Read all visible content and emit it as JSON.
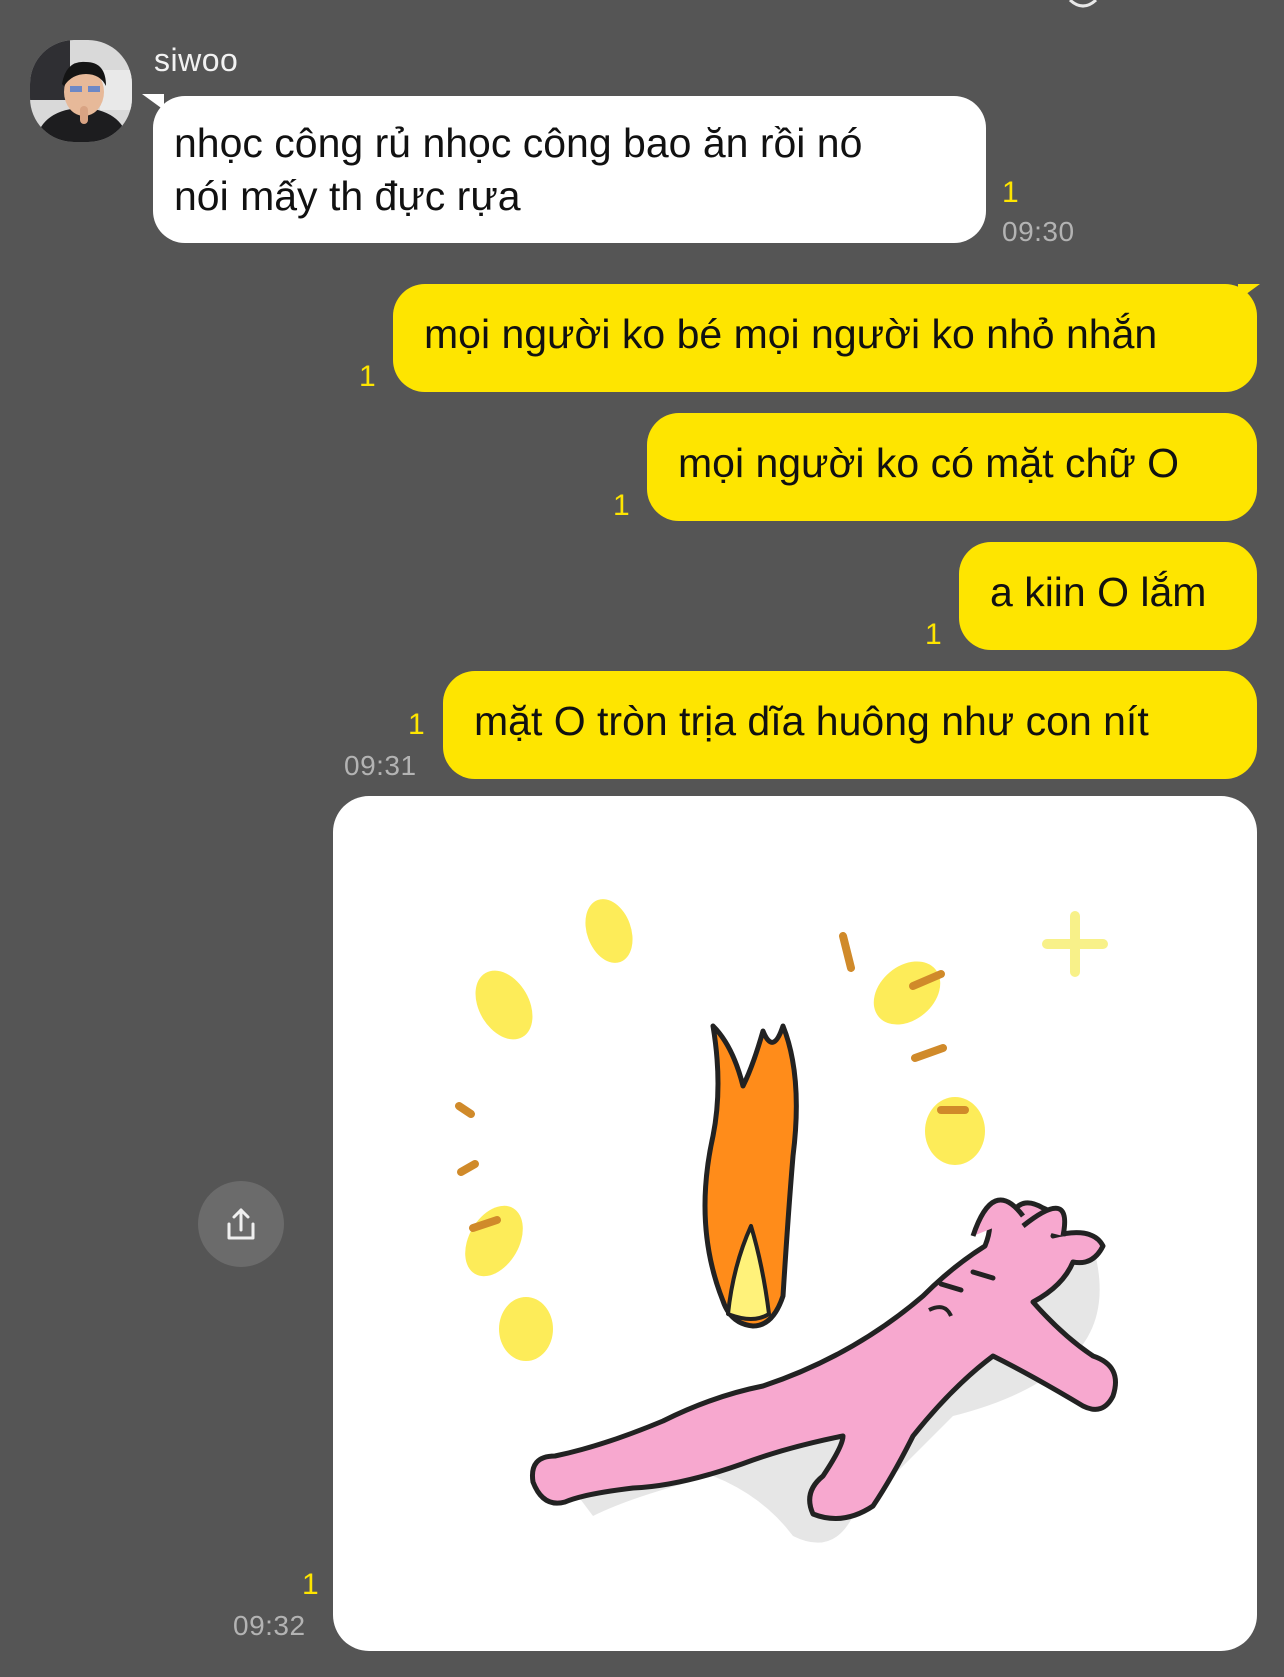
{
  "chat": {
    "incoming": {
      "sender": "siwoo",
      "lines": [
        "nhọc công rủ nhọc công bao ăn rồi nó",
        "nói mấy th đực rựa"
      ],
      "unread": "1",
      "time": "09:30"
    },
    "outgoing": [
      {
        "text": "mọi người ko bé mọi người ko nhỏ nhắn",
        "unread": "1"
      },
      {
        "text": "mọi người ko có mặt chữ O",
        "unread": "1"
      },
      {
        "text": "a kiin O lắm",
        "unread": "1"
      },
      {
        "text": "mặt O tròn trịa dĩa huông như con nít",
        "unread": "1",
        "time": "09:31"
      }
    ],
    "sticker": {
      "unread": "1",
      "time": "09:32"
    }
  },
  "icons": {
    "share": "share-icon",
    "avatar": "avatar-photo"
  },
  "colors": {
    "background": "#555555",
    "outgoing_bubble": "#fee500",
    "incoming_bubble": "#ffffff",
    "unread": "#fee500",
    "time": "#b3b3b3"
  }
}
